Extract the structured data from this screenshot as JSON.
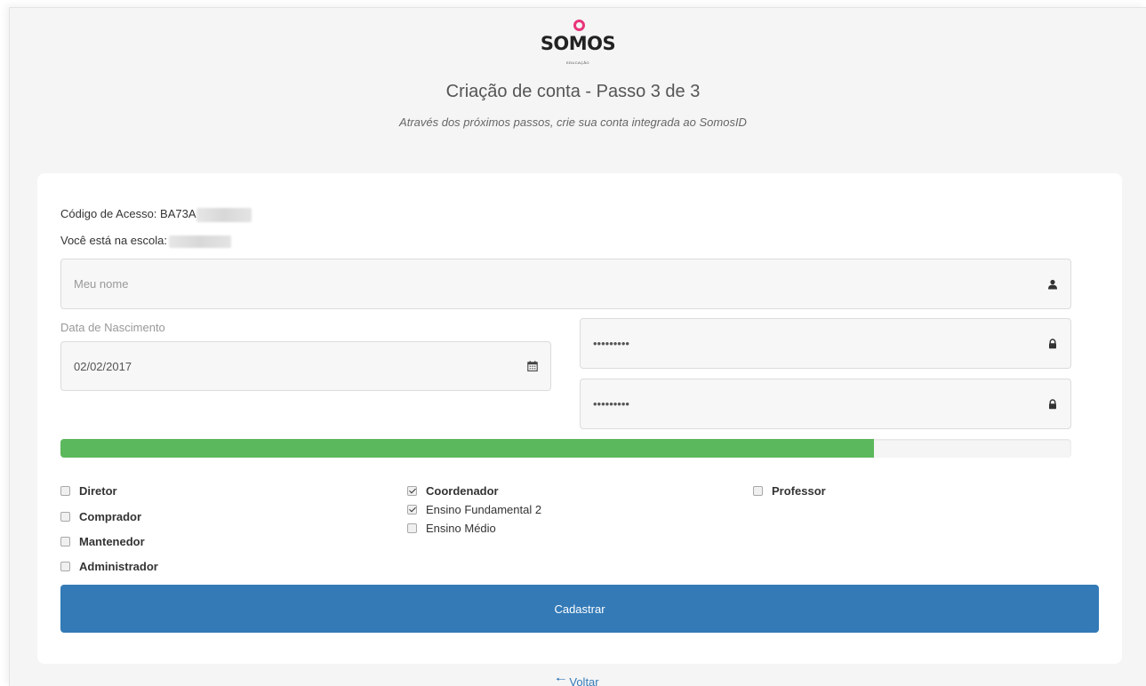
{
  "brand": {
    "logo_text": "SOMOS",
    "logo_sub": "EDUCAÇÃO",
    "accent_color": "#e8347a"
  },
  "header": {
    "title": "Criação de conta - Passo 3 de 3",
    "subtitle": "Através dos próximos passos, crie sua conta integrada ao SomosID"
  },
  "info": {
    "access_code_label": "Código de Acesso: BA73A",
    "school_label": "Você está na escola:"
  },
  "form": {
    "name_placeholder": "Meu nome",
    "name_icon": "user-icon",
    "birth_label": "Data de Nascimento",
    "birth_value": "02/02/2017",
    "birth_icon": "calendar-icon",
    "password_value": "123456789",
    "password_confirm_value": "123456789",
    "password_icon": "lock-icon"
  },
  "password_strength": {
    "fraction": 0.805,
    "color": "#5cb85c"
  },
  "roles": {
    "diretor": {
      "label": "Diretor",
      "checked": false
    },
    "comprador": {
      "label": "Comprador",
      "checked": false
    },
    "mantenedor": {
      "label": "Mantenedor",
      "checked": false
    },
    "administrador": {
      "label": "Administrador",
      "checked": false
    },
    "coordenador": {
      "label": "Coordenador",
      "checked": true
    },
    "ensino_fundamental_2": {
      "label": "Ensino Fundamental 2",
      "checked": true
    },
    "ensino_medio": {
      "label": "Ensino Médio",
      "checked": false
    },
    "professor": {
      "label": "Professor",
      "checked": false
    }
  },
  "actions": {
    "submit_label": "Cadastrar",
    "submit_color": "#337ab7",
    "back_label": "Voltar",
    "back_icon": "arrow-left-icon"
  }
}
